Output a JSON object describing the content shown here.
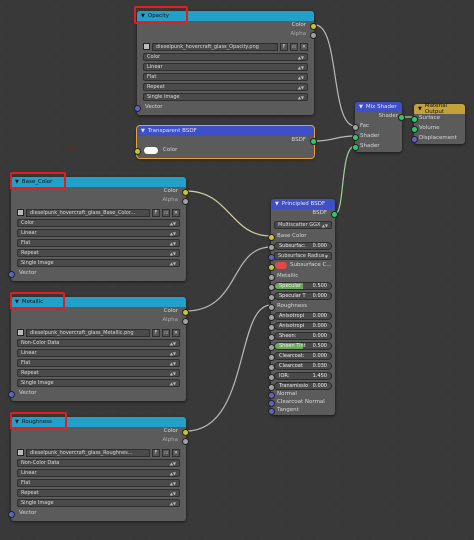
{
  "opacity_node": {
    "title": "Opacity",
    "out_color": "Color",
    "out_alpha": "Alpha",
    "file": "dieselpunk_hovercraft_glass_Opacity.png",
    "f_button": "F",
    "fields": [
      "Color",
      "Linear",
      "Flat",
      "Repeat",
      "Single Image"
    ],
    "in_vector": "Vector"
  },
  "transparent_node": {
    "title": "Transparent BSDF",
    "out_bsdf": "BSDF",
    "in_color": "Color"
  },
  "mix_node": {
    "title": "Mix Shader",
    "out_shader": "Shader",
    "in_fac": "Fac",
    "in_shader1": "Shader",
    "in_shader2": "Shader"
  },
  "output_node": {
    "title": "Material Output",
    "in_surface": "Surface",
    "in_volume": "Volume",
    "in_displacement": "Displacement"
  },
  "base_node": {
    "title": "Base_Color",
    "out_color": "Color",
    "out_alpha": "Alpha",
    "file": "dieselpunk_hovercraft_glass_Base_Color...",
    "f_button": "F",
    "fields": [
      "Color",
      "Linear",
      "Flat",
      "Repeat",
      "Single Image"
    ],
    "in_vector": "Vector"
  },
  "metallic_node": {
    "title": "Metallic",
    "out_color": "Color",
    "out_alpha": "Alpha",
    "file": "dieselpunk_hovercraft_glass_Metallic.png",
    "f_button": "F",
    "fields": [
      "Non-Color Data",
      "Linear",
      "Flat",
      "Repeat",
      "Single Image"
    ],
    "in_vector": "Vector"
  },
  "rough_node": {
    "title": "Roughness",
    "out_color": "Color",
    "out_alpha": "Alpha",
    "file": "dieselpunk_hovercraft_glass_Roughnes...",
    "f_button": "F",
    "fields": [
      "Non-Color Data",
      "Linear",
      "Flat",
      "Repeat",
      "Single Image"
    ],
    "in_vector": "Vector"
  },
  "principled_node": {
    "title": "Principled BSDF",
    "out_bsdf": "BSDF",
    "distribution": "Multiscatter GGX",
    "base_color": "Base Color",
    "subsurface_label": "Subsurfac:",
    "subsurface_value": "0.000",
    "subsurface_radius": "Subsurface Radius",
    "subsurface_color": "Subsurface C...",
    "metallic": "Metallic",
    "specular_label": "Specular",
    "specular_value": "0.500",
    "specular_fill": 0.5,
    "spec_tint_label": "Specular T",
    "spec_tint_value": "0.000",
    "roughness": "Roughness",
    "anisotropic_label": "Anisotropi",
    "anisotropic_value": "0.000",
    "aniso_rot_label": "Anisotropi",
    "aniso_rot_value": "0.000",
    "sheen_label": "Sheen:",
    "sheen_value": "0.000",
    "sheen_tint_label": "Sheen Tint",
    "sheen_tint_value": "0.500",
    "sheen_tint_fill": 0.5,
    "clearcoat_label": "Clearcoat:",
    "clearcoat_value": "0.000",
    "clearcoat_rough_label": "Clearcoat",
    "clearcoat_rough_value": "0.030",
    "ior_label": "IOR:",
    "ior_value": "1.450",
    "transmission_label": "Transmissio",
    "transmission_value": "0.000",
    "normal": "Normal",
    "clearcoat_normal": "Clearcoat Normal",
    "tangent": "Tangent"
  },
  "colors": {
    "teal": "#22a0c9",
    "blue": "#3f4fc7",
    "yellow": "#c4a23a",
    "highlight": "#e21f1f"
  }
}
